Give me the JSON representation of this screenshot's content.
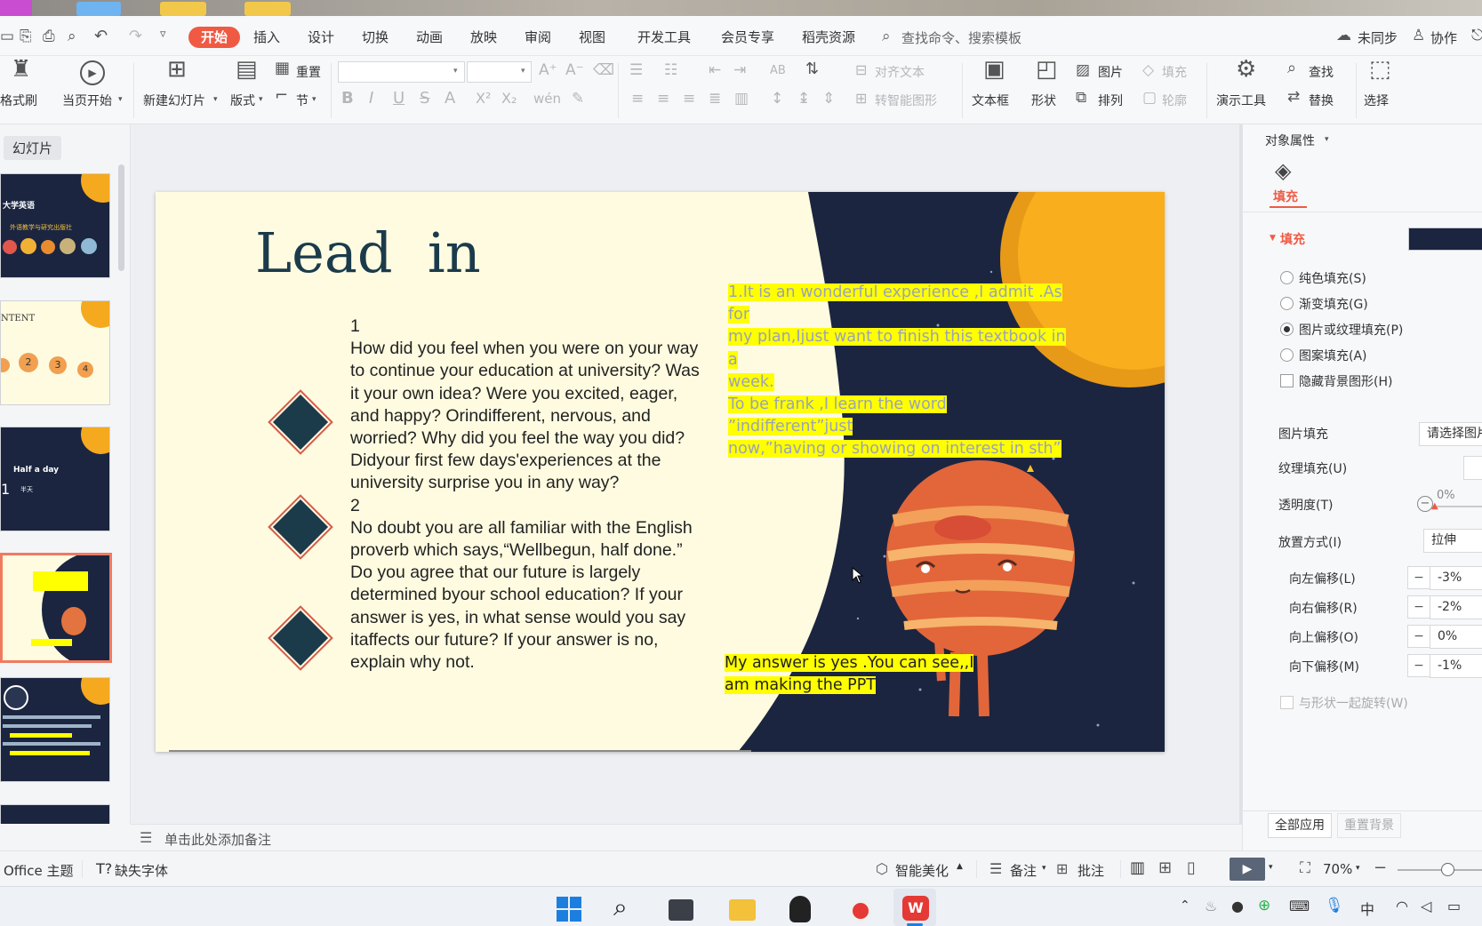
{
  "menu": {
    "tabs": [
      "开始",
      "插入",
      "设计",
      "切换",
      "动画",
      "放映",
      "审阅",
      "视图",
      "开发工具",
      "会员专享",
      "稻壳资源"
    ],
    "search_placeholder": "查找命令、搜索模板",
    "sync": "未同步",
    "collab": "协作"
  },
  "ribbon": {
    "format_painter": "格式刷",
    "play_current": "当页开始",
    "new_slide": "新建幻灯片",
    "layout": "版式",
    "reset": "重置",
    "section": "节",
    "align_text": "对齐文本",
    "smart_shape": "转智能图形",
    "textbox": "文本框",
    "shape": "形状",
    "picture": "图片",
    "arrange": "排列",
    "fill": "填充",
    "outline": "轮廓",
    "present_tools": "演示工具",
    "find": "查找",
    "replace": "替换",
    "select": "选择"
  },
  "thumbpane": {
    "label": "幻灯片",
    "thumb1_title": "大学英语",
    "thumb1_sub": "外语教学与研究出版社",
    "thumb2_title": "NTENT",
    "thumb3_title": "Half a day",
    "thumb3_num": "1",
    "thumb3_sub": "半天"
  },
  "slide": {
    "title": "Lead  in",
    "q1_num": "1",
    "q1_text": "How did you feel when you were on your way to continue your education at university? Was it your own idea? Were you excited, eager, and happy? Orindifferent, nervous, and worried? Why did you feel the way you did? Didyour first few days'experiences at the university surprise you in any way?",
    "q2_num": "2",
    "q2_text": "No doubt you are all familiar with the English proverb which says,“Wellbegun, half done.” Do you agree that our future is largely determined byour school education? If your answer is yes, in what sense would you say itaffects our future? If your answer is no, explain why not.",
    "answer1_lines": [
      "1.It is an wonderful experience ,I admit .As for",
      "my plan,Ijust want to finish this textbook in a",
      "week.",
      "To be frank ,I learn the word ”indifferent”just",
      "now,”having or showing on interest in sth”"
    ],
    "answer2_lines": [
      "My answer is yes .You can see,,I",
      "am making the PPT"
    ]
  },
  "rightpanel": {
    "header": "对象属性",
    "tab_fill": "填充",
    "section_fill": "填充",
    "options": [
      "纯色填充(S)",
      "渐变填充(G)",
      "图片或纹理填充(P)",
      "图案填充(A)"
    ],
    "hide_bg": "隐藏背景图形(H)",
    "pic_fill_label": "图片填充",
    "pic_fill_value": "请选择图片",
    "texture_label": "纹理填充(U)",
    "transparency_label": "透明度(T)",
    "transparency_value": "0%",
    "placement_label": "放置方式(I)",
    "placement_value": "拉伸",
    "offset_left_label": "向左偏移(L)",
    "offset_left_value": "-3%",
    "offset_right_label": "向右偏移(R)",
    "offset_right_value": "-2%",
    "offset_top_label": "向上偏移(O)",
    "offset_top_value": "0%",
    "offset_bottom_label": "向下偏移(M)",
    "offset_bottom_value": "-1%",
    "rotate_with_shape": "与形状一起旋转(W)",
    "apply_all": "全部应用",
    "reset_bg": "重置背景",
    "fill_color": "#1b2540"
  },
  "notes": {
    "placeholder": "单击此处添加备注"
  },
  "status": {
    "theme": "Office 主题",
    "missing_fonts": "缺失字体",
    "smart_beautify": "智能美化",
    "notes": "备注",
    "comments": "批注",
    "zoom": "70%"
  },
  "taskbar": {
    "ime": "中"
  }
}
